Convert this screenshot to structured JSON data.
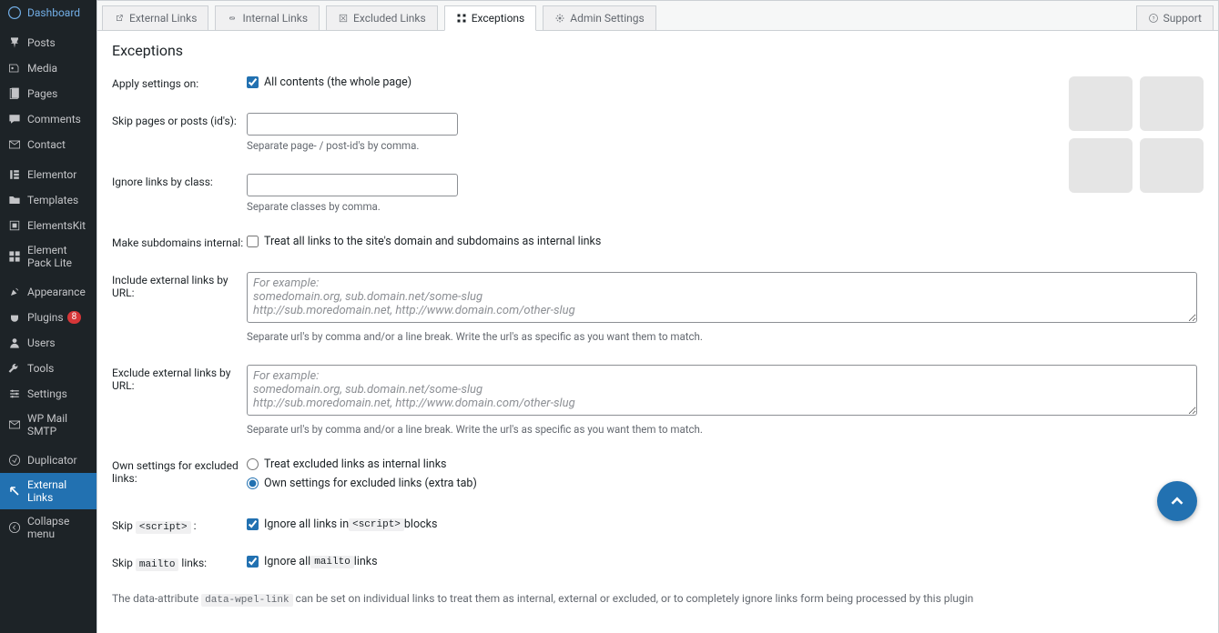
{
  "sidebar": {
    "items": [
      {
        "label": "Dashboard",
        "icon": "dashboard"
      },
      {
        "sep": true
      },
      {
        "label": "Posts",
        "icon": "pin"
      },
      {
        "label": "Media",
        "icon": "media"
      },
      {
        "label": "Pages",
        "icon": "page"
      },
      {
        "label": "Comments",
        "icon": "comment"
      },
      {
        "label": "Contact",
        "icon": "mail"
      },
      {
        "sep": true
      },
      {
        "label": "Elementor",
        "icon": "elementor"
      },
      {
        "label": "Templates",
        "icon": "folder"
      },
      {
        "label": "ElementsKit",
        "icon": "kit"
      },
      {
        "label": "Element Pack Lite",
        "icon": "pack"
      },
      {
        "sep": true
      },
      {
        "label": "Appearance",
        "icon": "brush"
      },
      {
        "label": "Plugins",
        "icon": "plug",
        "badge": "8"
      },
      {
        "label": "Users",
        "icon": "user"
      },
      {
        "label": "Tools",
        "icon": "wrench"
      },
      {
        "label": "Settings",
        "icon": "settings"
      },
      {
        "label": "WP Mail SMTP",
        "icon": "mail"
      },
      {
        "sep": true
      },
      {
        "label": "Duplicator",
        "icon": "dup"
      },
      {
        "label": "External Links",
        "icon": "external",
        "current": true
      },
      {
        "label": "Collapse menu",
        "icon": "collapse"
      }
    ]
  },
  "tabs": {
    "items": [
      {
        "label": "External Links"
      },
      {
        "label": "Internal Links"
      },
      {
        "label": "Excluded Links"
      },
      {
        "label": "Exceptions",
        "active": true
      },
      {
        "label": "Admin Settings"
      }
    ],
    "support": "Support"
  },
  "page": {
    "title": "Exceptions"
  },
  "form": {
    "apply_on": {
      "label": "Apply settings on:",
      "checkbox": "All contents (the whole page)"
    },
    "skip_pages": {
      "label": "Skip pages or posts (id's):",
      "value": "",
      "help": "Separate page- / post-id's by comma."
    },
    "ignore_class": {
      "label": "Ignore links by class:",
      "value": "",
      "help": "Separate classes by comma."
    },
    "subdomains": {
      "label": "Make subdomains internal:",
      "checkbox": "Treat all links to the site's domain and subdomains as internal links"
    },
    "include_ext": {
      "label": "Include external links by URL:",
      "placeholder": "For example:\nsomedomain.org, sub.domain.net/some-slug\nhttp://sub.moredomain.net, http://www.domain.com/other-slug",
      "help": "Separate url's by comma and/or a line break. Write the url's as specific as you want them to match."
    },
    "exclude_ext": {
      "label": "Exclude external links by URL:",
      "placeholder": "For example:\nsomedomain.org, sub.domain.net/some-slug\nhttp://sub.moredomain.net, http://www.domain.com/other-slug",
      "help": "Separate url's by comma and/or a line break. Write the url's as specific as you want them to match."
    },
    "own_settings": {
      "label": "Own settings for excluded links:",
      "opt1": "Treat excluded links as internal links",
      "opt2": "Own settings for excluded links (extra tab)"
    },
    "skip_script": {
      "label_pre": "Skip ",
      "label_code": "<script>",
      "label_post": " :",
      "check_pre": "Ignore all links in ",
      "check_code": "<script>",
      "check_post": " blocks"
    },
    "skip_mailto": {
      "label_pre": "Skip ",
      "label_code": "mailto",
      "label_post": " links:",
      "check_pre": "Ignore all ",
      "check_code": "mailto",
      "check_post": " links"
    }
  },
  "footnote": {
    "pre": "The data-attribute ",
    "code": "data-wpel-link",
    "post": " can be set on individual links to treat them as internal, external or excluded, or to completely ignore links form being processed by this plugin"
  }
}
